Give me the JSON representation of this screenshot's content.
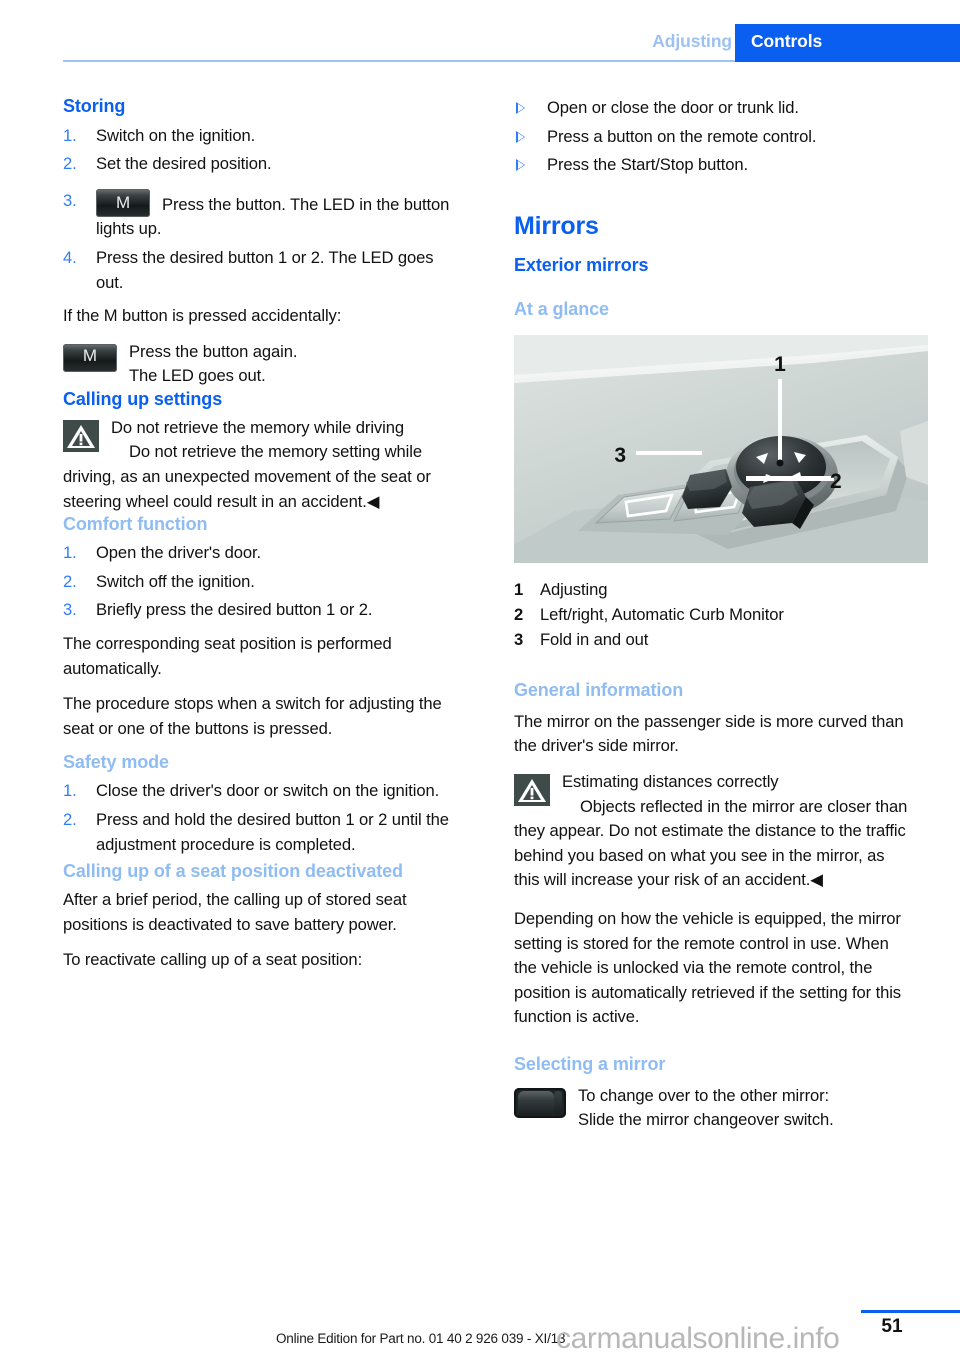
{
  "header": {
    "chapter": "Adjusting",
    "section": "Controls",
    "accent_color": "#0a5ff0",
    "chapter_color": "#9dc2f2"
  },
  "left_column": {
    "storing": {
      "heading": "Storing",
      "steps": [
        {
          "num": "1.",
          "text": "Switch on the ignition."
        },
        {
          "num": "2.",
          "text": "Set the desired position."
        },
        {
          "num": "3.",
          "icon": "m-button-icon",
          "icon_label": "M",
          "text": "Press the button. The LED in the button lights up."
        },
        {
          "num": "4.",
          "text": "Press the desired button 1 or 2. The LED goes out."
        }
      ],
      "accidental_intro": "If the M button is pressed accidentally:",
      "accidental_icon": "m-button-icon",
      "accidental_icon_label": "M",
      "accidental_line1": "Press the button again.",
      "accidental_line2": "The LED goes out."
    },
    "calling_up_settings": {
      "heading": "Calling up settings",
      "warning_icon": "warning-triangle-icon",
      "warning_title": "Do not retrieve the memory while driving",
      "warning_body": "Do not retrieve the memory setting while driving, as an unexpected movement of the seat or steering wheel could result in an accident.◀"
    },
    "comfort_function": {
      "heading": "Comfort function",
      "steps": [
        {
          "num": "1.",
          "text": "Open the driver's door."
        },
        {
          "num": "2.",
          "text": "Switch off the ignition."
        },
        {
          "num": "3.",
          "text": "Briefly press the desired button 1 or 2."
        }
      ],
      "para1": "The corresponding seat position is performed automatically.",
      "para2": "The procedure stops when a switch for adjusting the seat or one of the buttons is pressed."
    },
    "safety_mode": {
      "heading": "Safety mode",
      "steps": [
        {
          "num": "1.",
          "text": "Close the driver's door or switch on the ignition."
        },
        {
          "num": "2.",
          "text": "Press and hold the desired button 1 or 2 until the adjustment procedure is completed."
        }
      ]
    },
    "seat_position_deactivated": {
      "heading": "Calling up of a seat position deactivated",
      "para1": "After a brief period, the calling up of stored seat positions is deactivated to save battery power.",
      "para2": "To reactivate calling up of a seat position:"
    }
  },
  "right_column": {
    "reactivate_bullets": [
      "Open or close the door or trunk lid.",
      "Press a button on the remote control.",
      "Press the Start/Stop button."
    ],
    "mirrors": {
      "title": "Mirrors",
      "subtitle": "Exterior mirrors",
      "at_a_glance": "At a glance",
      "figure": {
        "name": "door-panel-mirror-controls-illustration",
        "callouts": [
          "1",
          "2",
          "3"
        ]
      },
      "legend": [
        {
          "num": "1",
          "text": "Adjusting"
        },
        {
          "num": "2",
          "text": "Left/right, Automatic Curb Monitor"
        },
        {
          "num": "3",
          "text": "Fold in and out"
        }
      ]
    },
    "general_information": {
      "heading": "General information",
      "para1": "The mirror on the passenger side is more curved than the driver's side mirror.",
      "warning_icon": "warning-triangle-icon",
      "warning_title": "Estimating distances correctly",
      "warning_body": "Objects reflected in the mirror are closer than they appear. Do not estimate the distance to the traffic behind you based on what you see in the mirror, as this will increase your risk of an accident.◀",
      "para2": "Depending on how the vehicle is equipped, the mirror setting is stored for the remote control in use. When the vehicle is unlocked via the remote control, the position is automatically retrieved if the setting for this function is active."
    },
    "selecting_a_mirror": {
      "heading": "Selecting a mirror",
      "icon": "mirror-changeover-switch-icon",
      "line1": "To change over to the other mirror:",
      "line2": "Slide the mirror changeover switch."
    }
  },
  "footer": {
    "edition": "Online Edition for Part no. 01 40 2 926 039 - XI/13",
    "page_number": "51",
    "watermark": "carmanualsonline.info"
  }
}
